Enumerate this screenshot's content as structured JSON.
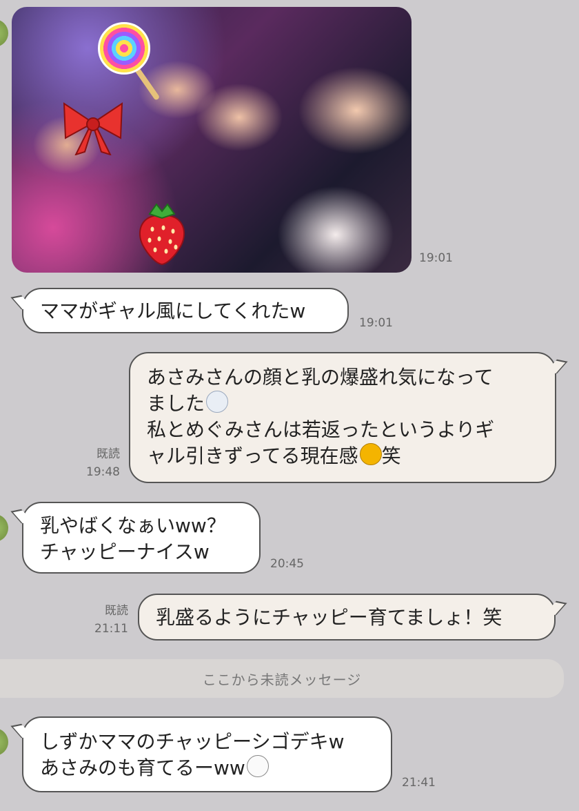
{
  "chat": {
    "photo": {
      "time": "19:01"
    },
    "messages": [
      {
        "side": "left",
        "text": "ママがギャル風にしてくれたw",
        "time": "19:01"
      },
      {
        "side": "right",
        "lines": [
          "あさみさんの顔と乳の爆盛れ気になって",
          "ました",
          "私とめぐみさんは若返ったというよりギ",
          "ャル引きずってる現在感",
          "笑"
        ],
        "read": "既読",
        "time": "19:48"
      },
      {
        "side": "left",
        "lines": [
          "乳やばくなぁいww？",
          "チャッピーナイスw"
        ],
        "time": "20:45"
      },
      {
        "side": "right",
        "text": "乳盛るようにチャッピー育てましょ！笑",
        "read": "既読",
        "time": "21:11"
      },
      {
        "side": "left",
        "lines": [
          "しずかママのチャッピーシゴデキw",
          "あさみのも育てるーww"
        ],
        "time": "21:41"
      }
    ],
    "unread_divider": "ここから未読メッセージ"
  },
  "icons": {
    "avatar": "avatar-icon",
    "lollipop": "lollipop-sticker-icon",
    "bow": "ribbon-bow-sticker-icon",
    "strawberry": "strawberry-sticker-icon",
    "ghost": "ghost-emoji-icon",
    "laugh": "laughing-emoji-icon",
    "bear": "bear-emoji-icon"
  }
}
